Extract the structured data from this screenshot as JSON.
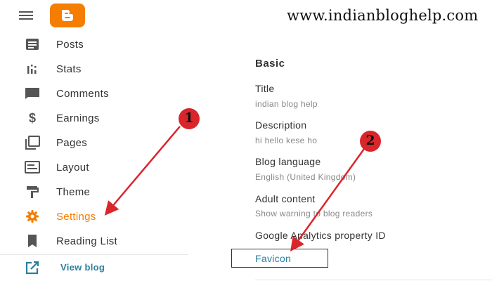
{
  "header": {
    "site_url": "www.indianbloghelp.com"
  },
  "sidebar": {
    "items": [
      {
        "label": "Posts",
        "icon": "posts-icon"
      },
      {
        "label": "Stats",
        "icon": "stats-icon"
      },
      {
        "label": "Comments",
        "icon": "comments-icon"
      },
      {
        "label": "Earnings",
        "icon": "dollar-icon"
      },
      {
        "label": "Pages",
        "icon": "pages-icon"
      },
      {
        "label": "Layout",
        "icon": "layout-icon"
      },
      {
        "label": "Theme",
        "icon": "paint-roller-icon"
      },
      {
        "label": "Settings",
        "icon": "gear-icon",
        "active": true
      },
      {
        "label": "Reading List",
        "icon": "bookmark-icon"
      }
    ],
    "view_blog": {
      "label": "View blog",
      "icon": "external-link-icon"
    }
  },
  "main": {
    "section_title": "Basic",
    "fields": [
      {
        "label": "Title",
        "value": "indian blog help"
      },
      {
        "label": "Description",
        "value": "hi hello kese ho"
      },
      {
        "label": "Blog language",
        "value": "English (United Kingdom)"
      },
      {
        "label": "Adult content",
        "value": "Show warning to blog readers"
      },
      {
        "label": "Google Analytics property ID"
      }
    ],
    "favicon_label": "Favicon"
  },
  "annotations": {
    "badge_1": "1",
    "badge_2": "2"
  },
  "colors": {
    "accent": "#f57d00",
    "link": "#2a7f9f",
    "arrow": "#d9262b"
  }
}
